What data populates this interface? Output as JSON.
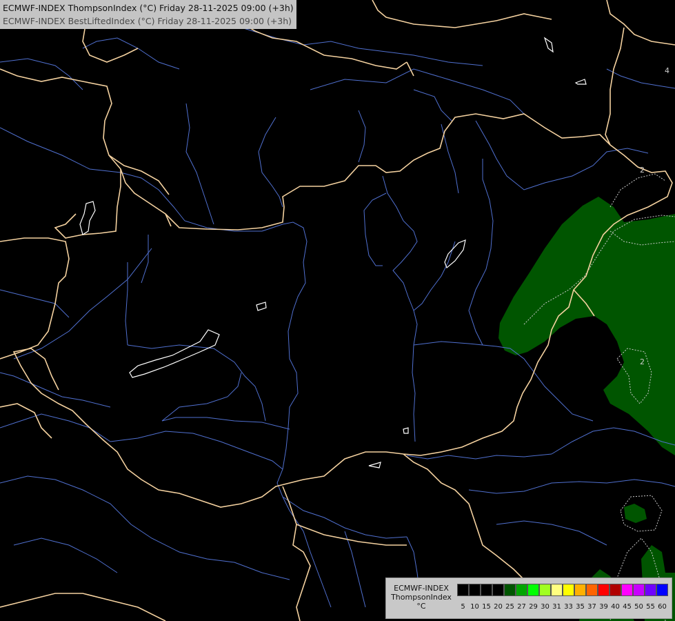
{
  "title": {
    "line1": "ECMWF-INDEX ThompsonIndex (°C) Friday 28-11-2025 09:00 (+3h)",
    "line2": "ECMWF-INDEX BestLiftedIndex (°C) Friday 28-11-2025 09:00 (+3h)"
  },
  "colors": {
    "background": "#000000",
    "border": "#f5d2a0",
    "river": "#5070d0",
    "lake": "#ffffff",
    "fill_20_25": "#005500",
    "contour": "#cccccc"
  },
  "contour_labels": [
    {
      "text": "2"
    },
    {
      "text": "4"
    }
  ],
  "legend": {
    "label_lines": [
      "ECMWF-INDEX",
      "ThompsonIndex",
      "°C"
    ],
    "swatches": [
      {
        "value": "5",
        "color": "#000000"
      },
      {
        "value": "10",
        "color": "#000000"
      },
      {
        "value": "15",
        "color": "#000000"
      },
      {
        "value": "20",
        "color": "#000000"
      },
      {
        "value": "25",
        "color": "#005500"
      },
      {
        "value": "27",
        "color": "#00a500"
      },
      {
        "value": "29",
        "color": "#00ff00"
      },
      {
        "value": "30",
        "color": "#a0ff20"
      },
      {
        "value": "31",
        "color": "#ffff80"
      },
      {
        "value": "33",
        "color": "#ffff00"
      },
      {
        "value": "35",
        "color": "#ffb000"
      },
      {
        "value": "37",
        "color": "#ff6400"
      },
      {
        "value": "39",
        "color": "#ff0000"
      },
      {
        "value": "40",
        "color": "#b00000"
      },
      {
        "value": "45",
        "color": "#ff00ff"
      },
      {
        "value": "50",
        "color": "#c800ff"
      },
      {
        "value": "55",
        "color": "#7000ff"
      },
      {
        "value": "60",
        "color": "#0000ff"
      }
    ]
  }
}
